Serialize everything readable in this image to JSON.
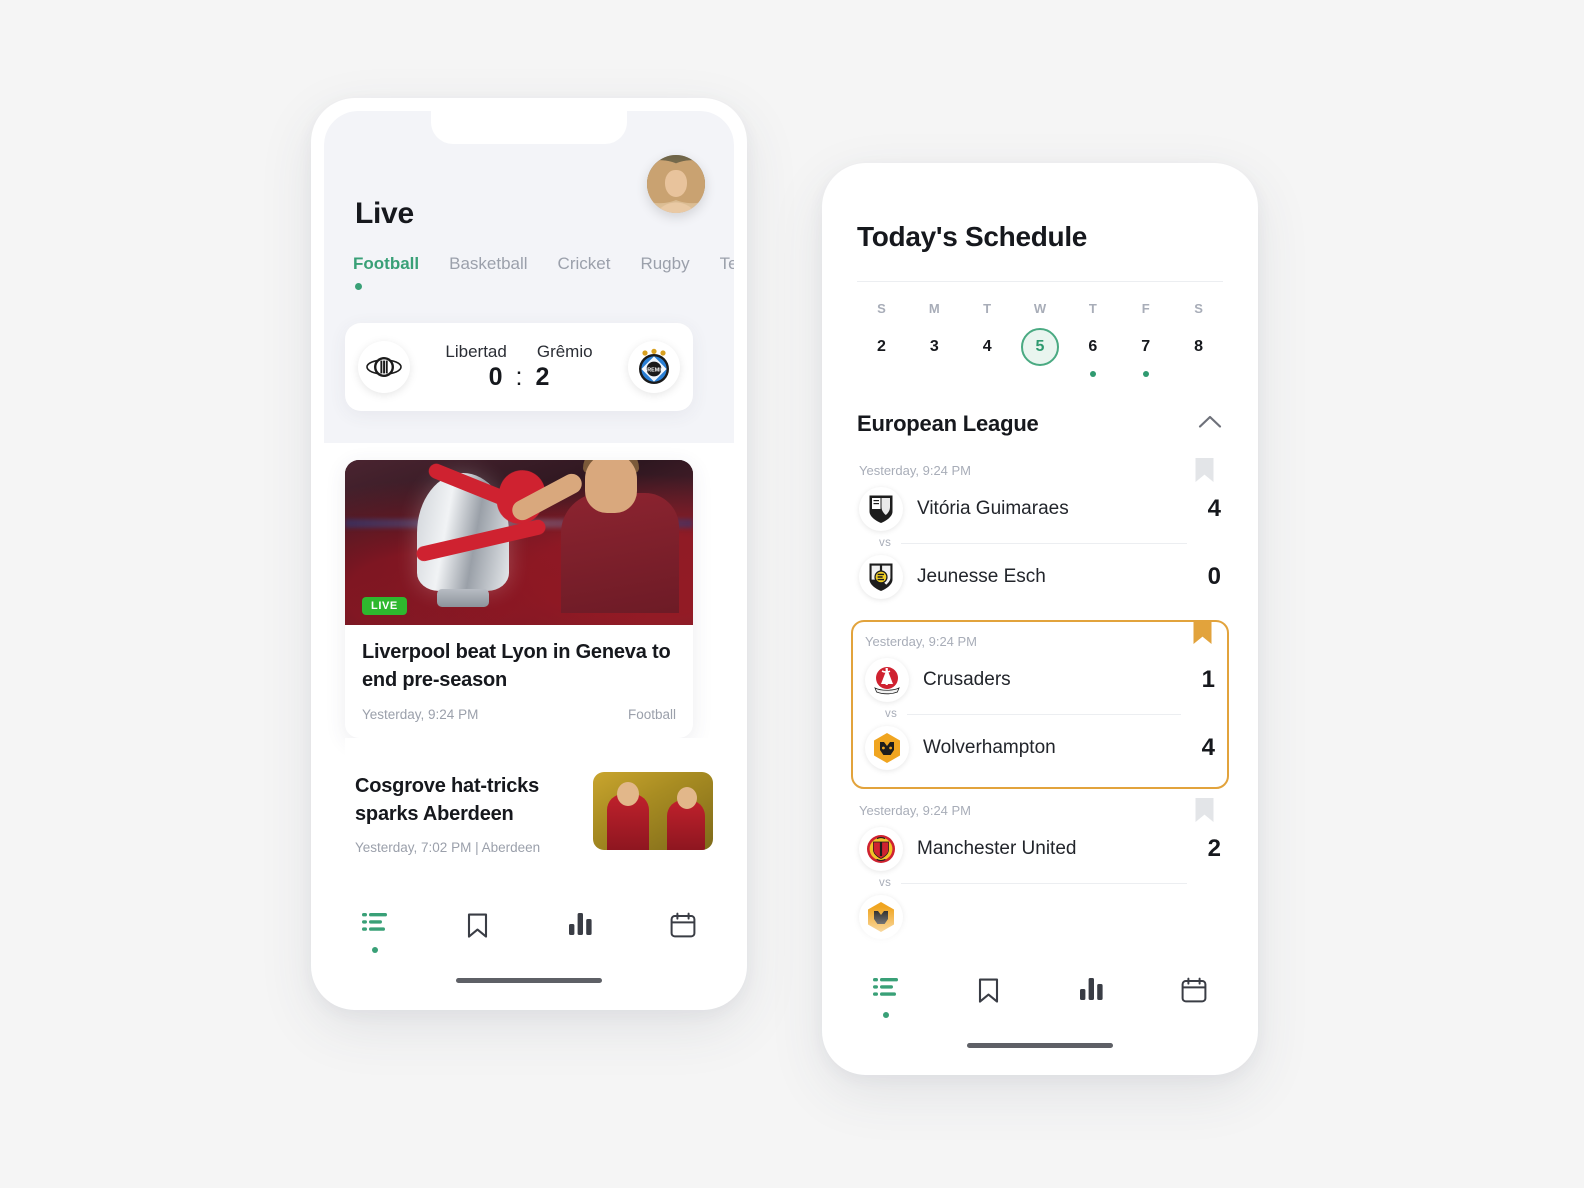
{
  "theme": {
    "page_bg": "#f5f5f5",
    "accent_green": "#39a077",
    "live_green": "#2eb82e",
    "highlight_orange": "#e2a33c",
    "header_band": "#f3f4f8"
  },
  "left_phone": {
    "title": "Live",
    "avatar_name": "user-avatar",
    "tabs": [
      {
        "label": "Football",
        "active": true
      },
      {
        "label": "Basketball",
        "active": false
      },
      {
        "label": "Cricket",
        "active": false
      },
      {
        "label": "Rugby",
        "active": false
      },
      {
        "label": "Te",
        "active": false
      }
    ],
    "live_score": {
      "home_team": "Libertad",
      "away_team": "Grêmio",
      "home_score": "0",
      "separator": ":",
      "away_score": "2",
      "home_crest": "libertad-crest",
      "away_crest": "gremio-crest"
    },
    "featured_article": {
      "badge": "LIVE",
      "title": "Liverpool beat Lyon in Geneva to end pre-season",
      "time": "Yesterday, 9:24 PM",
      "category": "Football"
    },
    "secondary_article": {
      "title": "Cosgrove hat-tricks sparks Aberdeen",
      "meta": "Yesterday, 7:02 PM  |  Aberdeen"
    },
    "nav": [
      {
        "icon": "feed-icon",
        "active": true
      },
      {
        "icon": "bookmark-icon",
        "active": false
      },
      {
        "icon": "stats-icon",
        "active": false
      },
      {
        "icon": "calendar-icon",
        "active": false
      }
    ]
  },
  "right_phone": {
    "title": "Today's Schedule",
    "week": [
      {
        "dow": "S",
        "num": "2",
        "selected": false,
        "dot": false
      },
      {
        "dow": "M",
        "num": "3",
        "selected": false,
        "dot": false
      },
      {
        "dow": "T",
        "num": "4",
        "selected": false,
        "dot": false
      },
      {
        "dow": "W",
        "num": "5",
        "selected": true,
        "dot": false
      },
      {
        "dow": "T",
        "num": "6",
        "selected": false,
        "dot": true
      },
      {
        "dow": "F",
        "num": "7",
        "selected": false,
        "dot": true
      },
      {
        "dow": "S",
        "num": "8",
        "selected": false,
        "dot": false
      }
    ],
    "league": {
      "name": "European League",
      "collapse_icon": "chevron-up-icon"
    },
    "matches": [
      {
        "time": "Yesterday, 9:24 PM",
        "bookmarked": false,
        "highlighted": false,
        "vs_label": "vs",
        "home": {
          "name": "Vitória Guimaraes",
          "score": "4",
          "crest": "vitoria-guimaraes-crest"
        },
        "away": {
          "name": "Jeunesse Esch",
          "score": "0",
          "crest": "jeunesse-esch-crest"
        }
      },
      {
        "time": "Yesterday, 9:24 PM",
        "bookmarked": true,
        "highlighted": true,
        "vs_label": "vs",
        "home": {
          "name": "Crusaders",
          "score": "1",
          "crest": "crusaders-crest"
        },
        "away": {
          "name": "Wolverhampton",
          "score": "4",
          "crest": "wolverhampton-crest"
        }
      },
      {
        "time": "Yesterday, 9:24 PM",
        "bookmarked": false,
        "highlighted": false,
        "vs_label": "vs",
        "home": {
          "name": "Manchester United",
          "score": "2",
          "crest": "manchester-united-crest"
        },
        "away": {
          "name": "",
          "score": "",
          "crest": "wolverhampton-crest"
        }
      }
    ],
    "nav": [
      {
        "icon": "feed-icon",
        "active": true
      },
      {
        "icon": "bookmark-icon",
        "active": false
      },
      {
        "icon": "stats-icon",
        "active": false
      },
      {
        "icon": "calendar-icon",
        "active": false
      }
    ]
  }
}
